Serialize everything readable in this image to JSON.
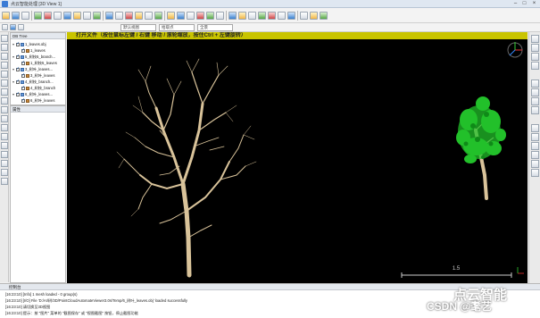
{
  "window": {
    "title": "点云智能处理 [3D View 1]"
  },
  "toolbar": {
    "combo_view": "默认视图",
    "combo_level": "拾取点",
    "combo_mode": "全景"
  },
  "db_tree": {
    "header": "DB Tree",
    "items": [
      {
        "label": "1_leaves.obj",
        "checked": true,
        "type": "mesh",
        "depth": 0
      },
      {
        "label": "1_leaves",
        "checked": true,
        "type": "cloud",
        "depth": 1
      },
      {
        "label": "5_树枝5_branch...",
        "checked": true,
        "type": "mesh",
        "depth": 0
      },
      {
        "label": "1_树枝5_leaves",
        "checked": true,
        "type": "cloud",
        "depth": 1
      },
      {
        "label": "3_树叶_leaves...",
        "checked": true,
        "type": "mesh",
        "depth": 0
      },
      {
        "label": "3_树叶_leaves",
        "checked": true,
        "type": "cloud",
        "depth": 1
      },
      {
        "label": "4_树枝_branch...",
        "checked": true,
        "type": "mesh",
        "depth": 0
      },
      {
        "label": "4_树枝_branch",
        "checked": true,
        "type": "cloud",
        "depth": 1
      },
      {
        "label": "6_树叶_leaves...",
        "checked": true,
        "type": "mesh",
        "depth": 0
      },
      {
        "label": "6_树叶_leaves",
        "checked": true,
        "type": "cloud",
        "depth": 1
      }
    ]
  },
  "properties": {
    "header": "属性"
  },
  "viewport": {
    "banner": "打开文件（按住鼠标左键 / 右键 移动 / 滚轮缩放，按住Ctrl + 左键旋转）",
    "scale_label": "1.5",
    "colors": {
      "background": "#000000",
      "banner": "#c9c400",
      "branches": "#d9c39a",
      "leaves": "#22c02a"
    }
  },
  "console": {
    "header": "控制台",
    "lines": [
      "[16:23:10] [Info] 1 mesh loaded - 0 group(s)",
      "[16:23:10] [I/O] File 'D:/AI/树/3D/PointCloudAutomateViewer3.0s/Temp/6_树叶_leaves.obj' loaded successfully",
      "[16:23:10] 请切换至3D视图",
      "[16:23:10] 提示：按 \"图片\" 菜单的 \"截图保存\" 或 \"视图截图\" 按钮，停止截图功能"
    ]
  },
  "watermark": {
    "top": "点云智能",
    "bottom": "CSDN @耄艺"
  }
}
